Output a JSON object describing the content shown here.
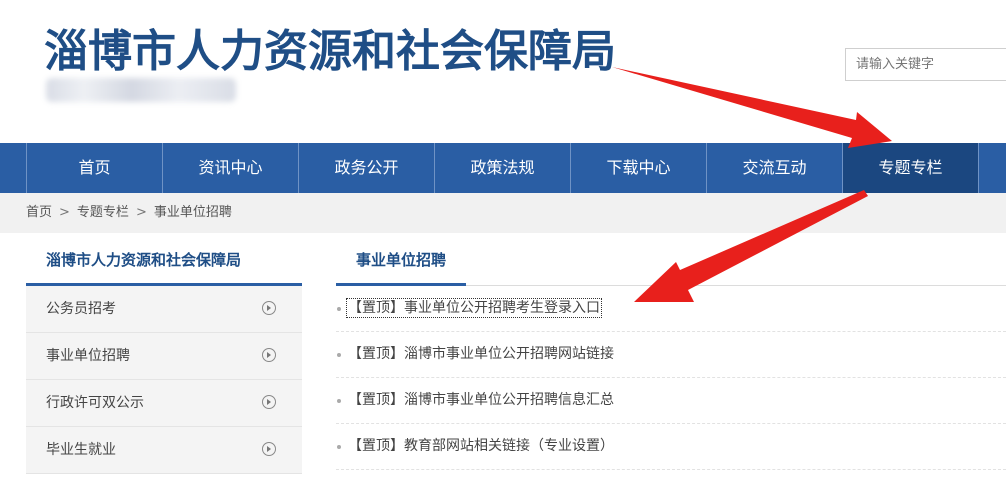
{
  "header": {
    "site_title": "淄博市人力资源和社会保障局",
    "search_placeholder": "请输入关键字"
  },
  "nav": {
    "items": [
      {
        "label": "首页"
      },
      {
        "label": "资讯中心"
      },
      {
        "label": "政务公开"
      },
      {
        "label": "政策法规"
      },
      {
        "label": "下载中心"
      },
      {
        "label": "交流互动"
      },
      {
        "label": "专题专栏",
        "active": true
      }
    ]
  },
  "breadcrumb": {
    "items": [
      "首页",
      "专题专栏",
      "事业单位招聘"
    ],
    "separator": ">"
  },
  "sidebar": {
    "title": "淄博市人力资源和社会保障局",
    "items": [
      {
        "label": "公务员招考"
      },
      {
        "label": "事业单位招聘"
      },
      {
        "label": "行政许可双公示"
      },
      {
        "label": "毕业生就业"
      }
    ]
  },
  "main": {
    "title": "事业单位招聘",
    "articles": [
      {
        "title": "【置顶】事业单位公开招聘考生登录入口"
      },
      {
        "title": "【置顶】淄博市事业单位公开招聘网站链接"
      },
      {
        "title": "【置顶】淄博市事业单位公开招聘信息汇总"
      },
      {
        "title": "【置顶】教育部网站相关链接（专业设置）"
      }
    ]
  },
  "colors": {
    "primary": "#2a5ea4",
    "primary_dark": "#1b4780",
    "title_blue": "#1f4e86",
    "annotation_red": "#e8201c"
  }
}
